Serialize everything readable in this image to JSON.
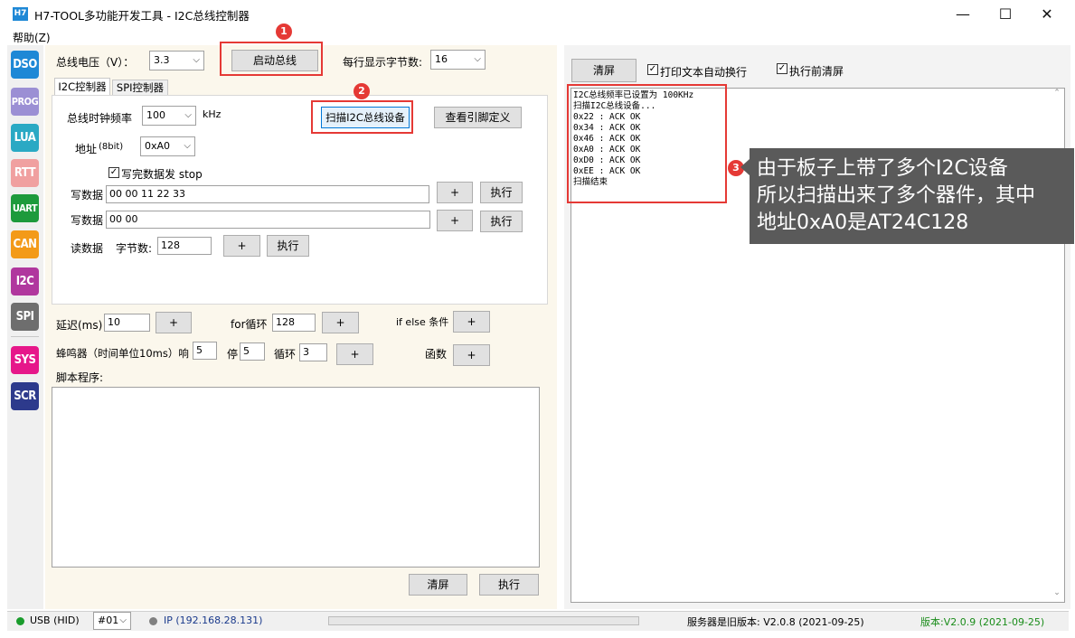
{
  "window": {
    "icon_label": "H7",
    "title": "H7-TOOL多功能开发工具 - I2C总线控制器",
    "minimize": "—",
    "maximize": "☐",
    "close": "✕"
  },
  "menu": {
    "help": "帮助(Z)"
  },
  "toolbar": [
    "DSO",
    "PROG",
    "LUA",
    "RTT",
    "UART",
    "CAN",
    "I2C",
    "SPI",
    "SYS",
    "SCR"
  ],
  "bus": {
    "voltage_label": "总线电压（V）：",
    "voltage_value": "3.3",
    "start_button": "启动总线",
    "bytes_per_line_label": "每行显示字节数:",
    "bytes_per_line_value": "16"
  },
  "tabs": {
    "i2c": "I2C控制器",
    "spi": "SPI控制器"
  },
  "i2c": {
    "clock_label": "总线时钟频率",
    "clock_value": "100",
    "clock_unit": "kHz",
    "scan_button": "扫描I2C总线设备",
    "pin_button": "查看引脚定义",
    "addr_label": "地址",
    "addr_hint": "(8bit)",
    "addr_value": "0xA0",
    "stop_checkbox": "写完数据发 stop",
    "write1_label": "写数据",
    "write1_value": "00 00 11 22 33",
    "write2_label": "写数据",
    "write2_value": "00 00",
    "read_label": "读数据",
    "bytes_label": "字节数:",
    "bytes_value": "128",
    "plus": "+",
    "exec": "执行"
  },
  "script": {
    "delay_label": "延迟(ms)",
    "delay_value": "10",
    "for_label": "for循环",
    "for_value": "128",
    "ifelse_label": "if else 条件",
    "beep_label": "蜂鸣器（时间单位10ms）响",
    "beep_on": "5",
    "stop_label": "停",
    "beep_off": "5",
    "loop_label": "循环",
    "loop_value": "3",
    "func_label": "函数",
    "program_label": "脚本程序:",
    "clear": "清屏",
    "exec": "执行"
  },
  "output": {
    "clear_button": "清屏",
    "wrap_checkbox": "打印文本自动换行",
    "clear_before_checkbox": "执行前清屏",
    "text": "I2C总线频率已设置为 100KHz\n扫描I2C总线设备...\n0x22 : ACK OK\n0x34 : ACK OK\n0x46 : ACK OK\n0xA0 : ACK OK\n0xD0 : ACK OK\n0xEE : ACK OK\n扫描结束"
  },
  "annotations": {
    "n1": "1",
    "n2": "2",
    "n3": "3",
    "callout_line1": "由于板子上带了多个I2C设备",
    "callout_line2": "所以扫描出来了多个器件，其中",
    "callout_line3": "地址0xA0是AT24C128"
  },
  "status": {
    "usb": "USB (HID)",
    "device": "#01",
    "ip": "IP (192.168.28.131)",
    "server": "服务器是旧版本: V2.0.8 (2021-09-25)",
    "version": "版本:V2.0.9 (2021-09-25)",
    "usb_dot_color": "#1a9c2c",
    "ip_dot_color": "#808080",
    "version_color": "#1a8c1a"
  },
  "colors": {
    "dso": "#1e88d6",
    "prog": "#9b8fd4",
    "lua": "#2aa9c4",
    "rtt": "#f0a0a0",
    "uart": "#1d9a3c",
    "can": "#f39a18",
    "i2c": "#b0379e",
    "spi": "#6e6e6e",
    "sys": "#e6178a",
    "scr": "#2d3a8c"
  }
}
